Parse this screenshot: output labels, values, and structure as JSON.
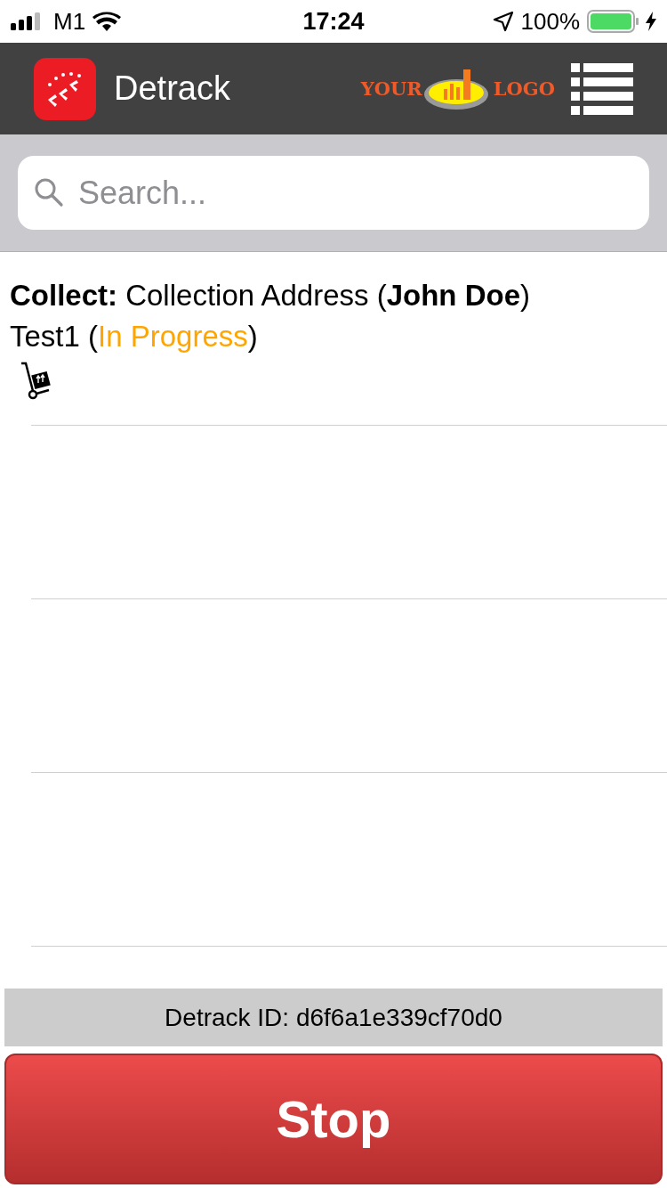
{
  "status_bar": {
    "carrier": "M1",
    "time": "17:24",
    "battery": "100%"
  },
  "header": {
    "app_title": "Detrack",
    "logo": {
      "left_text": "YOUR",
      "right_text": "LOGO"
    }
  },
  "search": {
    "placeholder": "Search..."
  },
  "jobs": [
    {
      "title": "**Collect:** Collection Address (**John Doe**)",
      "reference": "Test1 (",
      "status": "In Progress",
      "closing": ")",
      "color": "#ffa500"
    }
  ],
  "footer": {
    "detrack_id": "Detrack ID: d6f6a1e339cf70d0",
    "button": "Stop"
  }
}
